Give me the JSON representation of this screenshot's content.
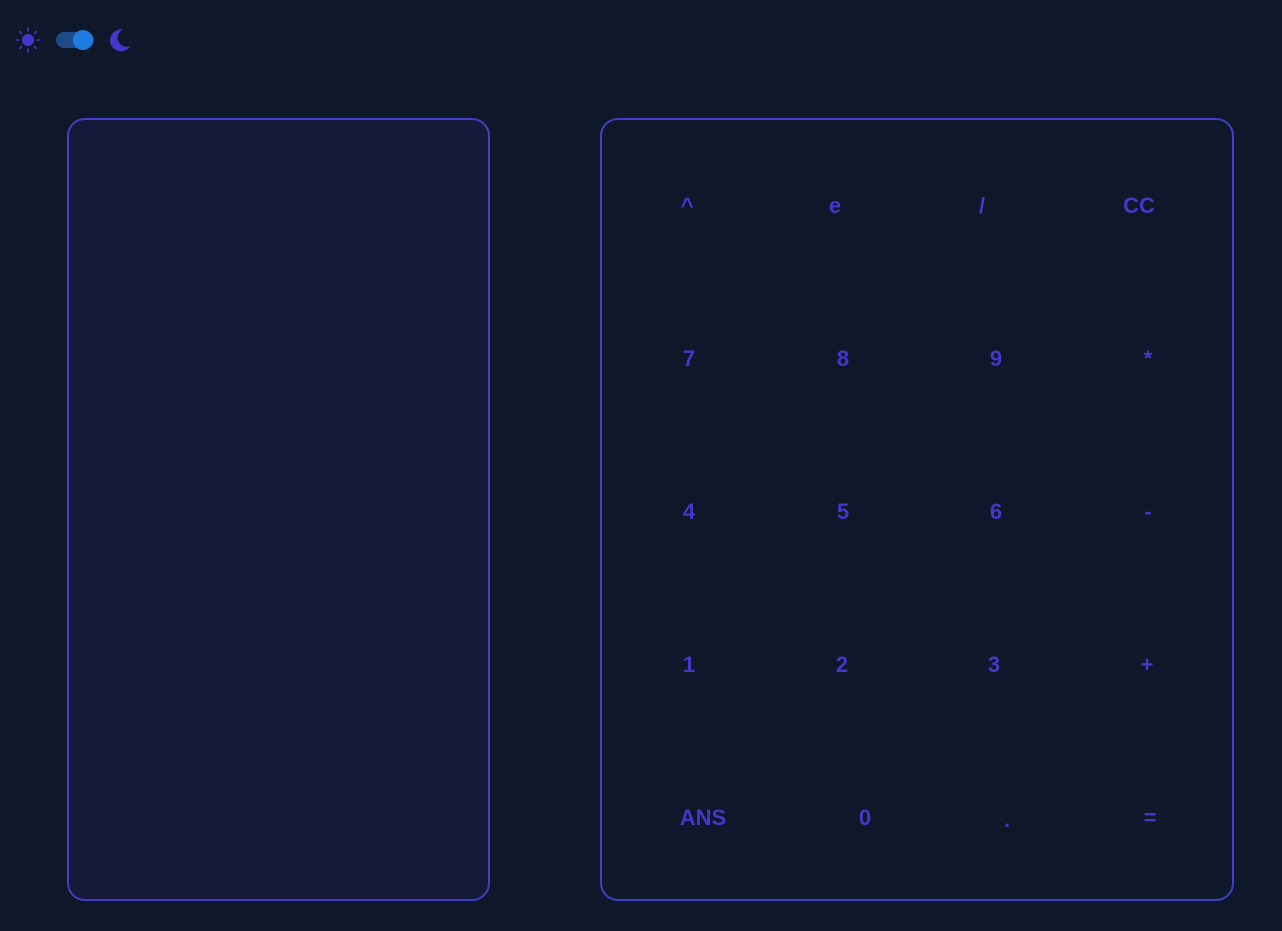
{
  "theme_toggle": {
    "light_icon": "sun-icon",
    "dark_icon": "moon-icon",
    "mode": "dark",
    "colors": {
      "icon": "#4338ca",
      "track": "#1e4a8a",
      "knob": "#1e7be0"
    }
  },
  "display": {
    "value": "",
    "colors": {
      "background": "#151a3b",
      "border": "#3f3fc9"
    }
  },
  "keypad": {
    "colors": {
      "key_text": "#4338ca",
      "border": "#3f3fc9",
      "background": "#0f172a"
    },
    "rows": [
      [
        "^",
        "e",
        "/",
        "CC"
      ],
      [
        "7",
        "8",
        "9",
        "*"
      ],
      [
        "4",
        "5",
        "6",
        "-"
      ],
      [
        "1",
        "2",
        "3",
        "+"
      ],
      [
        "ANS",
        "0",
        ".",
        "="
      ]
    ]
  }
}
